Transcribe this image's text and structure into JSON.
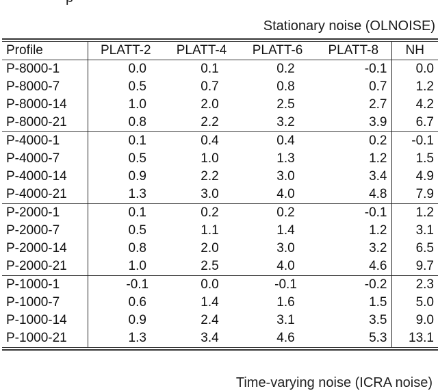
{
  "top_fragment": "p",
  "section_title": "Stationary noise (OLNOISE)",
  "table": {
    "headers": [
      "Profile",
      "PLATT-2",
      "PLATT-4",
      "PLATT-6",
      "PLATT-8",
      "NH"
    ],
    "groups": [
      {
        "rows": [
          [
            "P-8000-1",
            "0.0",
            "0.1",
            "0.2",
            "-0.1",
            "0.0"
          ],
          [
            "P-8000-7",
            "0.5",
            "0.7",
            "0.8",
            "0.7",
            "1.2"
          ],
          [
            "P-8000-14",
            "1.0",
            "2.0",
            "2.5",
            "2.7",
            "4.2"
          ],
          [
            "P-8000-21",
            "0.8",
            "2.2",
            "3.2",
            "3.9",
            "6.7"
          ]
        ]
      },
      {
        "rows": [
          [
            "P-4000-1",
            "0.1",
            "0.4",
            "0.4",
            "0.2",
            "-0.1"
          ],
          [
            "P-4000-7",
            "0.5",
            "1.0",
            "1.3",
            "1.2",
            "1.5"
          ],
          [
            "P-4000-14",
            "0.9",
            "2.2",
            "3.0",
            "3.4",
            "4.9"
          ],
          [
            "P-4000-21",
            "1.3",
            "3.0",
            "4.0",
            "4.8",
            "7.9"
          ]
        ]
      },
      {
        "rows": [
          [
            "P-2000-1",
            "0.1",
            "0.2",
            "0.2",
            "-0.1",
            "1.2"
          ],
          [
            "P-2000-7",
            "0.5",
            "1.1",
            "1.4",
            "1.2",
            "3.1"
          ],
          [
            "P-2000-14",
            "0.8",
            "2.0",
            "3.0",
            "3.2",
            "6.5"
          ],
          [
            "P-2000-21",
            "1.0",
            "2.5",
            "4.0",
            "4.6",
            "9.7"
          ]
        ]
      },
      {
        "rows": [
          [
            "P-1000-1",
            "-0.1",
            "0.0",
            "-0.1",
            "-0.2",
            "2.3"
          ],
          [
            "P-1000-7",
            "0.6",
            "1.4",
            "1.6",
            "1.5",
            "5.0"
          ],
          [
            "P-1000-14",
            "0.9",
            "2.4",
            "3.1",
            "3.5",
            "9.0"
          ],
          [
            "P-1000-21",
            "1.3",
            "3.4",
            "4.6",
            "5.3",
            "13.1"
          ]
        ]
      }
    ]
  },
  "next_section_title_clipped": "Time-varying noise (ICRA noise)"
}
